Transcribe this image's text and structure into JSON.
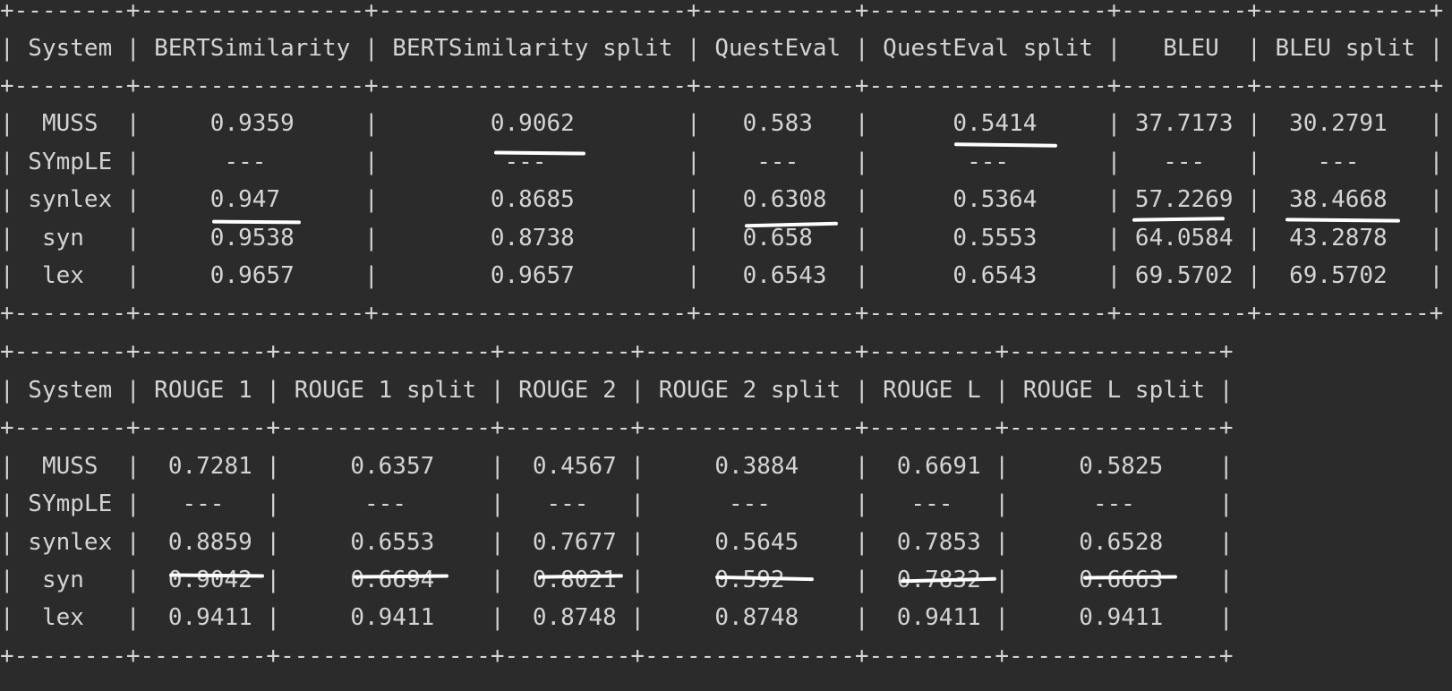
{
  "table1": {
    "border_top": "+--------+----------------+----------------------+-----------+-----------------+---------+------------+",
    "header": "| System | BERTSimilarity | BERTSimilarity split | QuestEval | QuestEval split |   BLEU  | BLEU split |",
    "border_mid": "+--------+----------------+----------------------+-----------+-----------------+---------+------------+",
    "rows": [
      "|  MUSS  |     0.9359     |        0.9062        |   0.583   |      0.5414     | 37.7173 |  30.2791   |",
      "| SYmpLE |      ---       |         ---          |    ---    |       ---       |   ---   |    ---     |",
      "| synlex |     0.947      |        0.8685        |   0.6308  |      0.5364     | 57.2269 |  38.4668   |",
      "|  syn   |     0.9538     |        0.8738        |   0.658   |      0.5553     | 64.0584 |  43.2878   |",
      "|  lex   |     0.9657     |        0.9657        |   0.6543  |      0.6543     | 69.5702 |  69.5702   |"
    ],
    "border_bottom": "+--------+----------------+----------------------+-----------+-----------------+---------+------------+"
  },
  "table2": {
    "border_top": "+--------+---------+---------------+---------+---------------+---------+---------------+",
    "header": "| System | ROUGE 1 | ROUGE 1 split | ROUGE 2 | ROUGE 2 split | ROUGE L | ROUGE L split |",
    "border_mid": "+--------+---------+---------------+---------+---------------+---------+---------------+",
    "rows": [
      "|  MUSS  |  0.7281 |     0.6357    |  0.4567 |     0.3884    |  0.6691 |     0.5825    |",
      "| SYmpLE |   ---   |      ---      |   ---   |      ---      |   ---   |      ---      |",
      "| synlex |  0.8859 |     0.6553    |  0.7677 |     0.5645    |  0.7853 |     0.6528    |",
      "|  syn   |  0.9042 |     0.6694    |  0.8021 |     0.592     |  0.7832 |     0.6663    |",
      "|  lex   |  0.9411 |     0.9411    |  0.8748 |     0.8748    |  0.9411 |     0.9411    |"
    ],
    "border_bottom": "+--------+---------+---------------+---------+---------------+---------+---------------+"
  },
  "colors": {
    "background": "#2b2b2b",
    "text": "#d4d4d4",
    "annotation": "#ffffff"
  }
}
